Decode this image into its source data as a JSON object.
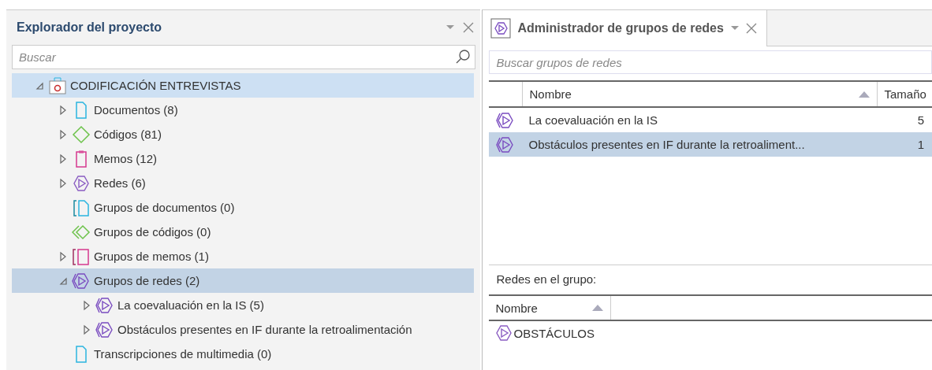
{
  "explorer": {
    "title": "Explorador del proyecto",
    "search": {
      "placeholder": "Buscar"
    },
    "tree": [
      {
        "label": "CODIFICACIÓN ENTREVISTAS",
        "kind": "project",
        "expanded": true,
        "selected": true,
        "children": [
          {
            "label": "Documentos (8)",
            "kind": "document",
            "expanded": false,
            "selected": false
          },
          {
            "label": "Códigos (81)",
            "kind": "code",
            "expanded": false,
            "selected": false
          },
          {
            "label": "Memos (12)",
            "kind": "memo",
            "expanded": false,
            "selected": false
          },
          {
            "label": "Redes (6)",
            "kind": "network",
            "expanded": false,
            "selected": false
          },
          {
            "label": "Grupos de documentos (0)",
            "kind": "document-group",
            "selected": false
          },
          {
            "label": "Grupos de códigos (0)",
            "kind": "code-group",
            "selected": false
          },
          {
            "label": "Grupos de memos (1)",
            "kind": "memo-group",
            "expanded": false,
            "selected": false
          },
          {
            "label": "Grupos de redes (2)",
            "kind": "network-group",
            "expanded": true,
            "selected": true,
            "children": [
              {
                "label": "La coevaluación en la IS (5)",
                "kind": "network-group",
                "expanded": false,
                "selected": false
              },
              {
                "label": "Obstáculos presentes en IF durante la retroalimentación",
                "kind": "network-group",
                "expanded": false,
                "selected": false
              }
            ]
          },
          {
            "label": "Transcripciones de multimedia (0)",
            "kind": "document",
            "selected": false
          }
        ]
      }
    ]
  },
  "manager": {
    "tab": {
      "title": "Administrador de grupos de redes",
      "selected": true
    },
    "search": {
      "placeholder": "Buscar grupos de redes"
    },
    "columns": [
      {
        "label": "Nombre",
        "sorted": true
      },
      {
        "label": "Tamaño",
        "sorted": false
      }
    ],
    "rows": [
      {
        "name": "La coevaluación en la IS",
        "size": "5",
        "selected": false
      },
      {
        "name": "Obstáculos presentes en IF durante la retroaliment...",
        "size": "1",
        "selected": true
      }
    ],
    "members_label": "Redes en el grupo:",
    "members_columns": [
      {
        "label": "Nombre",
        "sorted": true
      }
    ],
    "members": [
      {
        "name": "OBSTÁCULOS"
      }
    ]
  }
}
